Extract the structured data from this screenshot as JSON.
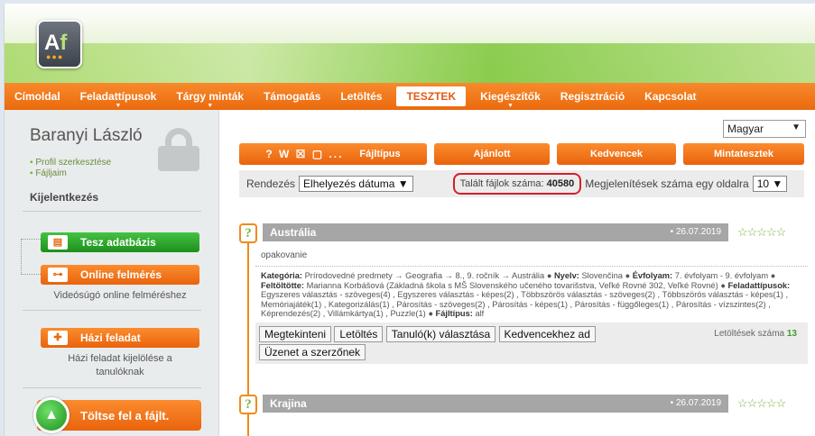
{
  "logo": {
    "text_a": "A",
    "text_f": "f",
    "dots": "●●●"
  },
  "nav": {
    "items": [
      {
        "label": "Címoldal",
        "dropdown": false
      },
      {
        "label": "Feladattípusok",
        "dropdown": true
      },
      {
        "label": "Tárgy minták",
        "dropdown": true
      },
      {
        "label": "Támogatás",
        "dropdown": false
      },
      {
        "label": "Letöltés",
        "dropdown": false
      },
      {
        "label": "TESZTEK",
        "dropdown": false,
        "active": true
      },
      {
        "label": "Kiegészítők",
        "dropdown": true
      },
      {
        "label": "Regisztráció",
        "dropdown": false
      },
      {
        "label": "Kapcsolat",
        "dropdown": false
      }
    ],
    "dropdown_glyph": "▼"
  },
  "sidebar": {
    "user_name": "Baranyi László",
    "links": [
      "Profil szerkesztése",
      "Fájljaim"
    ],
    "logout": "Kijelentkezés",
    "db_button": "Tesz adatbázis",
    "online_button": "Online felmérés",
    "online_caption": "Videósúgó online felméréshez",
    "homework_button": "Házi feladat",
    "homework_caption_1": "Házi feladat kijelölése a",
    "homework_caption_2": "tanulóknak",
    "upload_button": "Töltse fel a fájlt."
  },
  "main": {
    "language": "Magyar",
    "toolbar": {
      "icons": "? W ☒ ▢ ...",
      "filetype": "Fájltípus",
      "recommended": "Ajánlott",
      "favorites": "Kedvencek",
      "sample_tests": "Mintatesztek"
    },
    "sort": {
      "label": "Rendezés",
      "value": "Elhelyezés dátuma",
      "found_label": "Talált fájlok száma:",
      "found_count": "40580",
      "perpage_label": "Megjelenítések száma egy oldalra",
      "perpage_value": "10"
    },
    "cards": [
      {
        "title": "Austrália",
        "date": "• 26.07.2019",
        "stars": "☆☆☆☆☆",
        "subtitle": "opakovanie",
        "desc": {
          "k1": "Kategória:",
          "v1": " Prírodovedné predmety → Geografia → 8., 9. ročník → Austrália ● ",
          "k2": "Nyelv:",
          "v2": " Slovenčina ● ",
          "k3": "Évfolyam:",
          "v3": " 7. évfolyam - 9. évfolyam ● ",
          "k4": "Feltöltötte:",
          "v4": " Marianna Korbášová (Základná škola s MŠ Slovenského učeného tovarišstva, Veľké Rovné 302, Veľké Rovné) ● ",
          "k5": "Feladattípusok:",
          "v5": " Egyszeres választás - szöveges(4) , Egyszeres választás - képes(2) , Többszörös választás - szöveges(2) , Többszörös választás - képes(1) , Memóriajáték(1) , Kategorizálás(1) , Párosítás - szöveges(2) , Párosítás - képes(1) , Párosítás - függőleges(1) , Párosítás - vízszintes(2) , Képrendezés(2) , Villámkártya(1) , Puzzle(1) ● ",
          "k6": "Fájltípus:",
          "v6": " alf"
        },
        "actions": [
          "Megtekinteni",
          "Letöltés",
          "Tanuló(k) választása",
          "Kedvencekhez ad",
          "Üzenet a szerzőnek"
        ],
        "downloads_label": "Letöltések száma",
        "downloads": "13"
      },
      {
        "title": "Krajina",
        "date": "• 26.07.2019",
        "stars": "☆☆☆☆☆"
      }
    ]
  }
}
